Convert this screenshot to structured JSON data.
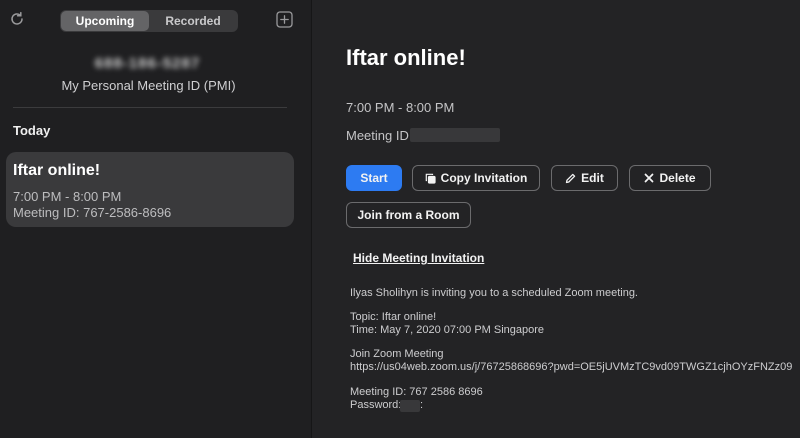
{
  "sidebar": {
    "tabs": [
      {
        "label": "Upcoming",
        "active": true
      },
      {
        "label": "Recorded",
        "active": false
      }
    ],
    "pmi_number": "688-186-5287",
    "pmi_label": "My Personal Meeting ID (PMI)",
    "section_label": "Today",
    "meetings": [
      {
        "title": "Iftar online!",
        "time": "7:00 PM - 8:00 PM",
        "meeting_id": "Meeting ID: 767-2586-8696"
      }
    ]
  },
  "detail": {
    "title": "Iftar online!",
    "time": "7:00 PM - 8:00 PM",
    "meeting_id_label": "Meeting ID:",
    "buttons": {
      "start": "Start",
      "copy_invitation": "Copy Invitation",
      "edit": "Edit",
      "delete": "Delete",
      "join_room": "Join from a Room"
    },
    "hide_invitation": "Hide Meeting Invitation",
    "invitation": {
      "intro": "Ilyas Sholihyn is inviting you to a scheduled Zoom meeting.",
      "topic": "Topic: Iftar online!",
      "time": "Time: May 7, 2020 07:00 PM Singapore",
      "join_heading": "Join Zoom Meeting",
      "join_url": "https://us04web.zoom.us/j/76725868696?pwd=OE5jUVMzTC9vd09TWGZ1cjhOYzFNZz09",
      "meeting_id": "Meeting ID: 767 2586 8696",
      "password_label": "Password:",
      "password_suffix": ":"
    }
  },
  "colors": {
    "accent": "#2d7bf2",
    "sidebar_bg": "#1f1f21",
    "main_bg": "#232325",
    "card_bg": "#3a3a3c"
  }
}
